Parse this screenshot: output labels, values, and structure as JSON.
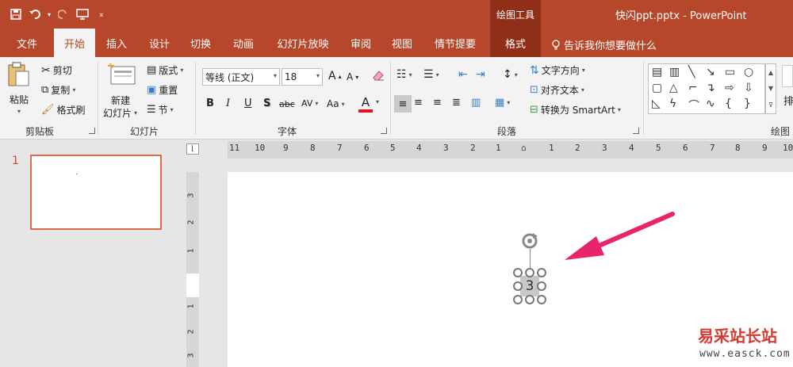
{
  "titlebar": {
    "context_tools": "绘图工具",
    "doc_title": "快闪ppt.pptx  -  PowerPoint"
  },
  "tabs": [
    "文件",
    "开始",
    "插入",
    "设计",
    "切换",
    "动画",
    "幻灯片放映",
    "审阅",
    "视图",
    "情节提要",
    "格式"
  ],
  "tell_me": "告诉我你想要做什么",
  "clipboard": {
    "paste": "粘贴",
    "cut": "剪切",
    "copy": "复制",
    "format_painter": "格式刷",
    "label": "剪贴板"
  },
  "slides_group": {
    "new_slide_line1": "新建",
    "new_slide_line2": "幻灯片",
    "layout": "版式",
    "reset": "重置",
    "section": "节",
    "label": "幻灯片"
  },
  "font": {
    "name": "等线 (正文)",
    "size": "18",
    "grow": "A",
    "shrink": "A",
    "bold": "B",
    "italic": "I",
    "underline": "U",
    "shadow": "S",
    "strike": "abc",
    "spacing": "AV",
    "case": "Aa",
    "color": "A",
    "label": "字体"
  },
  "paragraph": {
    "text_direction": "文字方向",
    "align_text": "对齐文本",
    "smartart": "转换为 SmartArt",
    "label": "段落"
  },
  "drawing": {
    "label": "绘图",
    "arrange_partial": "排"
  },
  "thumbnails": {
    "slide_number": "1"
  },
  "ruler": {
    "horizontal": [
      "11",
      "10",
      "9",
      "8",
      "7",
      "6",
      "5",
      "4",
      "3",
      "2",
      "1",
      "0",
      "1",
      "2",
      "3",
      "4",
      "5",
      "6",
      "7",
      "8",
      "9",
      "10"
    ],
    "vertical": [
      "3",
      "2",
      "1",
      "1",
      "2",
      "3"
    ]
  },
  "slide": {
    "selected_text": "3"
  },
  "annotation": {
    "arrow_color": "#e8246a"
  },
  "watermark": {
    "text": "易采站长站",
    "url": "www.easck.com"
  },
  "colors": {
    "accent": "#b7472a",
    "context_tab": "#8f2f17"
  }
}
